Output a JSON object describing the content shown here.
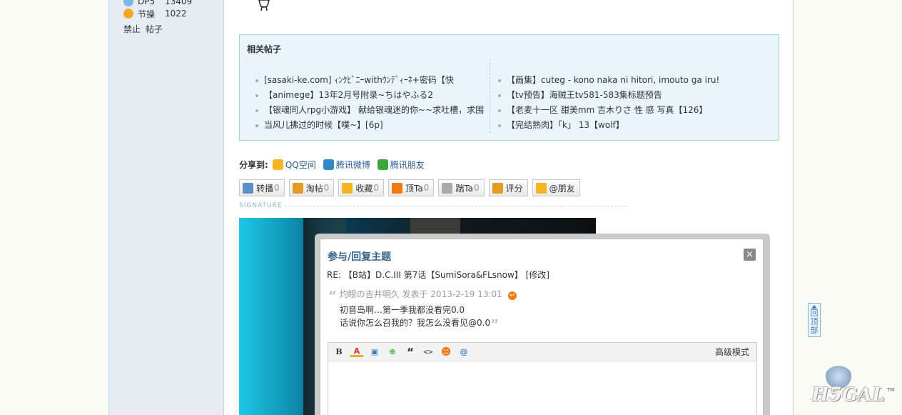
{
  "sidebar": {
    "stats": [
      {
        "label": "DP5",
        "value": "13409",
        "icon": "star-icon",
        "color": "#5fa0d8"
      },
      {
        "label": "节操",
        "value": "1022",
        "icon": "bulb-icon",
        "color": "#f0a920"
      }
    ],
    "links": [
      "禁止",
      "帖子"
    ]
  },
  "related": {
    "title": "相关帖子",
    "left": [
      "[sasaki-ke.com] ｨﾝｸﾋﾞﾆｰwithｳﾝﾃﾞｨｰﾈ+密码【快",
      "【animege】13年2月号附录~ちはやふる2",
      "【银魂同人rpg小游戏】 献给银魂迷的你~~求吐槽，求围",
      "当风儿拂过的时候【噗~】[6p]"
    ],
    "right": [
      "【画集】cuteg - kono naka ni hitori, imouto ga iru!",
      "【tv预告】海贼王tv581-583集标题预告",
      "【老麦十一区 甜美mm 吉木りさ 性 感 写真【126】",
      "【完结熟肉】「k」 13【wolf】"
    ]
  },
  "share": {
    "label": "分享到:",
    "items": [
      {
        "name": "QQ空间",
        "icon": "qzone-icon",
        "color": "#f5b622"
      },
      {
        "name": "腾讯微博",
        "icon": "tencent-weibo-icon",
        "color": "#3189c5"
      },
      {
        "name": "腾讯朋友",
        "icon": "pengyou-icon",
        "color": "#3ba73b"
      }
    ]
  },
  "actions": [
    {
      "label": "转播",
      "count": "0",
      "icon": "forward-icon",
      "color": "#5a8fc7"
    },
    {
      "label": "淘帖",
      "count": "0",
      "icon": "collect-box-icon",
      "color": "#e59a23"
    },
    {
      "label": "收藏",
      "count": "0",
      "icon": "star-icon",
      "color": "#f5b622"
    },
    {
      "label": "顶Ta",
      "count": "0",
      "icon": "up-arrow-icon",
      "color": "#f07a14"
    },
    {
      "label": "踹Ta",
      "count": "0",
      "icon": "down-arrow-icon",
      "color": "#aaaaaa"
    },
    {
      "label": "评分",
      "count": "",
      "icon": "thumb-icon",
      "color": "#e59a23"
    },
    {
      "label": "@朋友",
      "count": "",
      "icon": "friends-icon",
      "color": "#f5b622"
    }
  ],
  "signature_label": "SIGNATURE",
  "dialog": {
    "title": "参与/回复主题",
    "close": "×",
    "subject": "RE: 【B站】D.C.III 第7话【SumiSora&FLsnow】 [修改]",
    "quote_meta": "灼眼の吉井明久 发表于 2013-2-19 13:01",
    "quote_lines": [
      "初音岛啊…第一季我都没看完0.0",
      "话说你怎么召我的？我怎么没看见@0.0"
    ],
    "toolbar": {
      "buttons": [
        {
          "icon": "bold-icon",
          "glyph": "B"
        },
        {
          "icon": "font-color-icon",
          "glyph": "A"
        },
        {
          "icon": "image-icon",
          "glyph": "▣"
        },
        {
          "icon": "link-icon",
          "glyph": "⊕"
        },
        {
          "icon": "quote-icon",
          "glyph": "“"
        },
        {
          "icon": "code-icon",
          "glyph": "<>"
        },
        {
          "icon": "smiley-icon",
          "glyph": "☻"
        },
        {
          "icon": "at-icon",
          "glyph": "@"
        }
      ],
      "advanced": "高级模式"
    }
  },
  "backtop": [
    "回",
    "顶",
    "部"
  ],
  "logo": {
    "text": "H5GAL",
    "tm": "TM"
  }
}
